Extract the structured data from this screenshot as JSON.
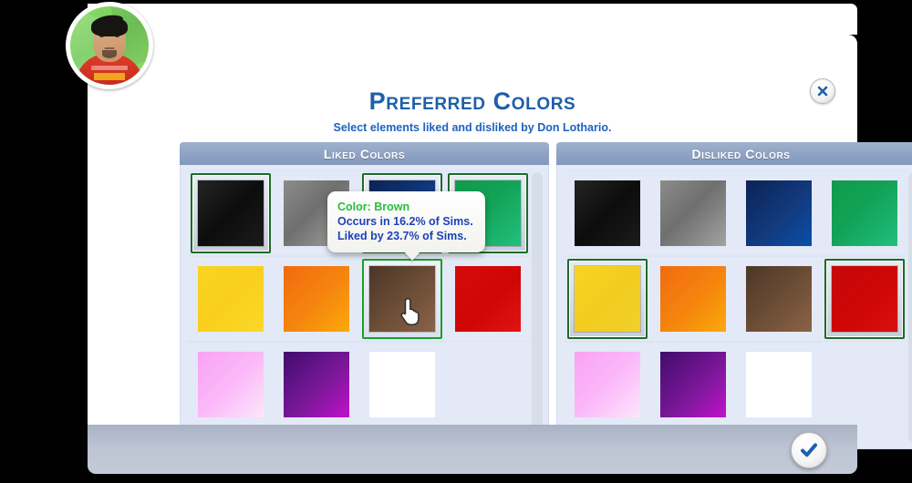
{
  "dialog": {
    "title": "Preferred Colors",
    "subtitle": "Select elements liked and disliked by Don Lothario.",
    "close_icon": "close-icon",
    "confirm_icon": "checkmark-icon"
  },
  "avatar": {
    "name": "sim-portrait",
    "hair_color": "#171512",
    "shirt_color": "#d3301f",
    "background_color": "#7fd15e"
  },
  "panels": [
    {
      "key": "liked",
      "header": "Liked Colors",
      "swatches": [
        {
          "name": "black",
          "label": "Black",
          "css": "linear-gradient(135deg, #242424 0%, #0d0d0d 50%, #1b1b1b 100%)",
          "state": "selected"
        },
        {
          "name": "gray",
          "label": "Gray",
          "css": "linear-gradient(135deg, #8c8c8c 0%, #6f6f6f 45%, #a3a3a3 100%)",
          "state": "normal"
        },
        {
          "name": "navy",
          "label": "Navy",
          "css": "linear-gradient(135deg, #0b2255 0%, #123a7e 55%, #0a4fa8 100%)",
          "state": "selected"
        },
        {
          "name": "green",
          "label": "Green",
          "css": "linear-gradient(135deg, #0f9b4a 0%, #12a257 45%, #22c07e 100%)",
          "state": "selected"
        },
        {
          "name": "yellow",
          "label": "Yellow",
          "css": "linear-gradient(135deg, #f8d423 0%, #f9cf1c 50%, #fbd829 100%)",
          "state": "normal"
        },
        {
          "name": "orange",
          "label": "Orange",
          "css": "linear-gradient(135deg, #f26a11 0%, #f5860d 55%, #fba90c 100%)",
          "state": "normal"
        },
        {
          "name": "brown",
          "label": "Brown",
          "css": "linear-gradient(135deg, #4b3628 0%, #6b4c35 50%, #8a6348 100%)",
          "state": "hovered"
        },
        {
          "name": "red",
          "label": "Red",
          "css": "linear-gradient(135deg, #d60a0a 0%, #cf0606 55%, #e21414 100%)",
          "state": "normal"
        },
        {
          "name": "pink",
          "label": "Pink",
          "css": "linear-gradient(135deg, #f9a2f4 0%, #fbb8f8 50%, #fde6fb 100%)",
          "state": "normal"
        },
        {
          "name": "purple",
          "label": "Purple",
          "css": "linear-gradient(135deg, #3f0d6b 0%, #7a1799 55%, #c013c9 100%)",
          "state": "normal"
        },
        {
          "name": "white",
          "label": "White",
          "css": "linear-gradient(135deg, #ffffff 0%, #ffffff 100%)",
          "state": "normal"
        }
      ]
    },
    {
      "key": "disliked",
      "header": "Disliked Colors",
      "swatches": [
        {
          "name": "black",
          "label": "Black",
          "css": "linear-gradient(135deg, #242424 0%, #0d0d0d 50%, #1b1b1b 100%)",
          "state": "normal"
        },
        {
          "name": "gray",
          "label": "Gray",
          "css": "linear-gradient(135deg, #8c8c8c 0%, #6f6f6f 45%, #a3a3a3 100%)",
          "state": "normal"
        },
        {
          "name": "navy",
          "label": "Navy",
          "css": "linear-gradient(135deg, #0b2255 0%, #123a7e 55%, #0a4fa8 100%)",
          "state": "normal"
        },
        {
          "name": "green",
          "label": "Green",
          "css": "linear-gradient(135deg, #0f9b4a 0%, #12a257 45%, #22c07e 100%)",
          "state": "normal"
        },
        {
          "name": "yellow",
          "label": "Yellow",
          "css": "linear-gradient(135deg, #f8d423 0%, #f2cc1f 50%, #f0d02a 100%)",
          "state": "selected"
        },
        {
          "name": "orange",
          "label": "Orange",
          "css": "linear-gradient(135deg, #f26a11 0%, #f5860d 55%, #fba90c 100%)",
          "state": "normal"
        },
        {
          "name": "brown",
          "label": "Brown",
          "css": "linear-gradient(135deg, #4b3628 0%, #6b4c35 50%, #8a6348 100%)",
          "state": "normal"
        },
        {
          "name": "red",
          "label": "Red",
          "css": "linear-gradient(135deg, #c50808 0%, #cf0606 55%, #d81010 100%)",
          "state": "selected"
        },
        {
          "name": "pink",
          "label": "Pink",
          "css": "linear-gradient(135deg, #f9a2f4 0%, #fbb8f8 50%, #fde6fb 100%)",
          "state": "normal"
        },
        {
          "name": "purple",
          "label": "Purple",
          "css": "linear-gradient(135deg, #3f0d6b 0%, #7a1799 55%, #c013c9 100%)",
          "state": "normal"
        },
        {
          "name": "white",
          "label": "White",
          "css": "linear-gradient(135deg, #ffffff 0%, #ffffff 100%)",
          "state": "normal"
        }
      ]
    }
  ],
  "tooltip": {
    "color_line": "Color: Brown",
    "occurs_line": "Occurs in 16.2% of Sims.",
    "liked_line": "Liked by 23.7% of Sims.",
    "title_color": "#2bbd3e",
    "stat_color": "#1e42b8"
  },
  "cursor": {
    "icon": "hand-pointer-cursor"
  }
}
